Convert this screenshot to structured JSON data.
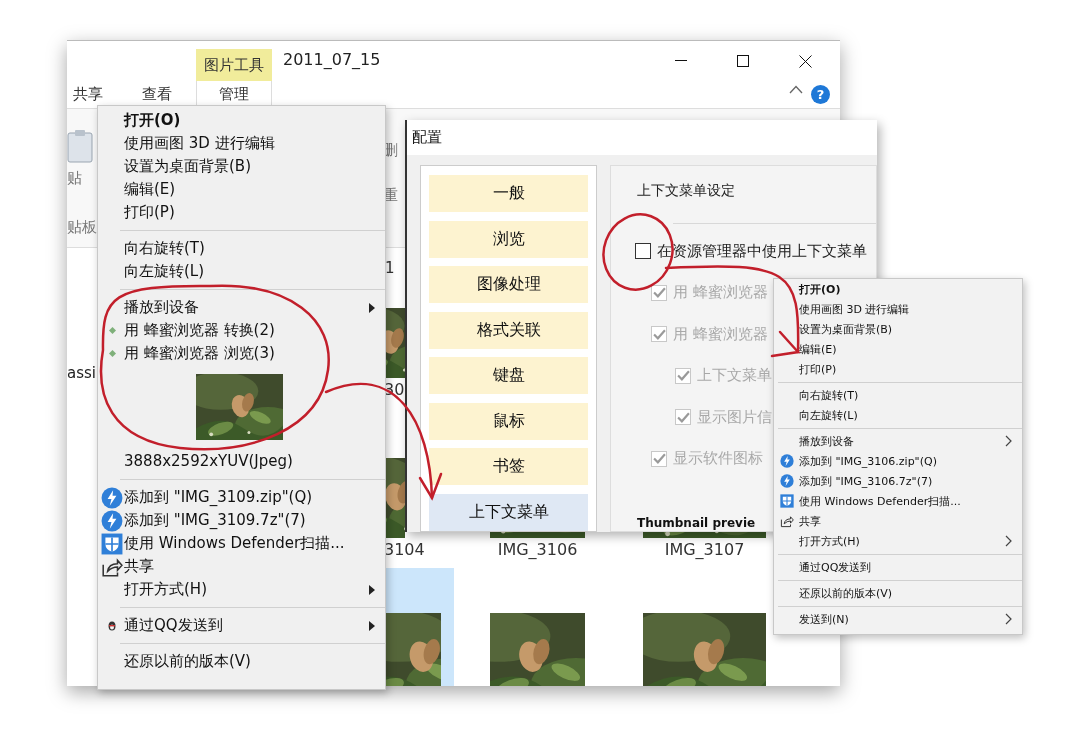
{
  "explorer": {
    "contextual_tab": "图片工具",
    "title": "2011_07_15",
    "tabs": [
      {
        "label": "共享",
        "selected": false
      },
      {
        "label": "查看",
        "selected": false
      },
      {
        "label": "管理",
        "selected": true
      }
    ],
    "help": "?",
    "ribbon": {
      "paste": "贴",
      "clipboard": "贴板",
      "delete": "删",
      "rename": "重"
    },
    "address": "1",
    "side_text": "assi",
    "rows": [
      [
        {
          "label": "30",
          "selected": false
        }
      ],
      [
        {
          "label": "3104",
          "selected": false
        },
        {
          "label": "IMG_3106",
          "selected": false
        },
        {
          "label": "IMG_3107",
          "selected": false
        }
      ],
      [
        {
          "selected": true
        },
        {
          "selected": false
        },
        {
          "selected": false
        }
      ]
    ]
  },
  "menus": {
    "left": {
      "items": [
        {
          "kind": "plain",
          "label": "打开(O)",
          "default": true,
          "submenu": false
        },
        {
          "kind": "plain",
          "label": "使用画图 3D 进行编辑",
          "default": false,
          "submenu": false
        },
        {
          "kind": "plain",
          "label": "设置为桌面背景(B)",
          "default": false,
          "submenu": false
        },
        {
          "kind": "plain",
          "label": "编辑(E)",
          "default": false,
          "submenu": false
        },
        {
          "kind": "plain",
          "label": "打印(P)",
          "default": false,
          "submenu": false
        },
        {
          "kind": "separator"
        },
        {
          "kind": "plain",
          "label": "向右旋转(T)",
          "default": false,
          "submenu": false
        },
        {
          "kind": "plain",
          "label": "向左旋转(L)",
          "default": false,
          "submenu": false
        },
        {
          "kind": "separator"
        },
        {
          "kind": "plain",
          "label": "播放到设备",
          "default": false,
          "submenu": true
        },
        {
          "kind": "viewer",
          "label": "用 蜂蜜浏览器 转换(2)",
          "default": false,
          "submenu": false
        },
        {
          "kind": "viewer",
          "label": "用 蜂蜜浏览器 浏览(3)",
          "default": false,
          "submenu": false
        },
        {
          "kind": "preview"
        },
        {
          "kind": "info",
          "label": "3888x2592xYUV(Jpeg)"
        },
        {
          "kind": "separator"
        },
        {
          "kind": "archive",
          "label": "添加到 \"IMG_3109.zip\"(Q)",
          "default": false,
          "submenu": false
        },
        {
          "kind": "archive",
          "label": "添加到 \"IMG_3109.7z\"(7)",
          "default": false,
          "submenu": false
        },
        {
          "kind": "scan",
          "label": "使用 Windows Defender扫描...",
          "default": false,
          "submenu": false
        },
        {
          "kind": "share",
          "label": "共享",
          "default": false,
          "submenu": false
        },
        {
          "kind": "plain",
          "label": "打开方式(H)",
          "default": false,
          "submenu": true
        },
        {
          "kind": "separator"
        },
        {
          "kind": "send",
          "label": "通过QQ发送到",
          "default": false,
          "submenu": true
        },
        {
          "kind": "separator"
        },
        {
          "kind": "plain",
          "label": "还原以前的版本(V)",
          "default": false,
          "submenu": false
        }
      ]
    },
    "right": {
      "items": [
        {
          "kind": "plain",
          "label": "打开(O)",
          "default": true,
          "submenu": false
        },
        {
          "kind": "plain",
          "label": "使用画图 3D 进行编辑",
          "default": false,
          "submenu": false
        },
        {
          "kind": "plain",
          "label": "设置为桌面背景(B)",
          "default": false,
          "submenu": false
        },
        {
          "kind": "plain",
          "label": "编辑(E)",
          "default": false,
          "submenu": false
        },
        {
          "kind": "plain",
          "label": "打印(P)",
          "default": false,
          "submenu": false
        },
        {
          "kind": "separator"
        },
        {
          "kind": "plain",
          "label": "向右旋转(T)",
          "default": false,
          "submenu": false
        },
        {
          "kind": "plain",
          "label": "向左旋转(L)",
          "default": false,
          "submenu": false
        },
        {
          "kind": "separator"
        },
        {
          "kind": "plain",
          "label": "播放到设备",
          "default": false,
          "submenu": true
        },
        {
          "kind": "archive",
          "label": "添加到 \"IMG_3106.zip\"(Q)",
          "default": false,
          "submenu": false
        },
        {
          "kind": "archive",
          "label": "添加到 \"IMG_3106.7z\"(7)",
          "default": false,
          "submenu": false
        },
        {
          "kind": "scan",
          "label": "使用 Windows Defender扫描...",
          "default": false,
          "submenu": false
        },
        {
          "kind": "share",
          "label": "共享",
          "default": false,
          "submenu": false
        },
        {
          "kind": "plain",
          "label": "打开方式(H)",
          "default": false,
          "submenu": true
        },
        {
          "kind": "separator"
        },
        {
          "kind": "plain",
          "label": "通过QQ发送到",
          "default": false,
          "submenu": false
        },
        {
          "kind": "separator"
        },
        {
          "kind": "plain",
          "label": "还原以前的版本(V)",
          "default": false,
          "submenu": false
        },
        {
          "kind": "separator"
        },
        {
          "kind": "plain",
          "label": "发送到(N)",
          "default": false,
          "submenu": true
        }
      ]
    }
  },
  "dialog": {
    "title": "配置",
    "nav": [
      {
        "label": "一般",
        "selected": false
      },
      {
        "label": "浏览",
        "selected": false
      },
      {
        "label": "图像处理",
        "selected": false
      },
      {
        "label": "格式关联",
        "selected": false
      },
      {
        "label": "键盘",
        "selected": false
      },
      {
        "label": "鼠标",
        "selected": false
      },
      {
        "label": "书签",
        "selected": false
      },
      {
        "label": "上下文菜单",
        "selected": true
      }
    ],
    "heading": "上下文菜单设定",
    "main_option": {
      "label": "在资源管理器中使用上下文菜单",
      "checked": false,
      "disabled": false
    },
    "options": [
      {
        "label": "用 蜂蜜浏览器",
        "checked": true,
        "disabled": true
      },
      {
        "label": "用 蜂蜜浏览器",
        "checked": true,
        "disabled": true,
        "children": [
          {
            "label": "上下文菜单",
            "checked": true,
            "disabled": true
          },
          {
            "label": "显示图片信",
            "checked": true,
            "disabled": true
          }
        ]
      },
      {
        "label": "显示软件图标",
        "checked": true,
        "disabled": true
      }
    ],
    "section": "Thumbnail previe"
  }
}
